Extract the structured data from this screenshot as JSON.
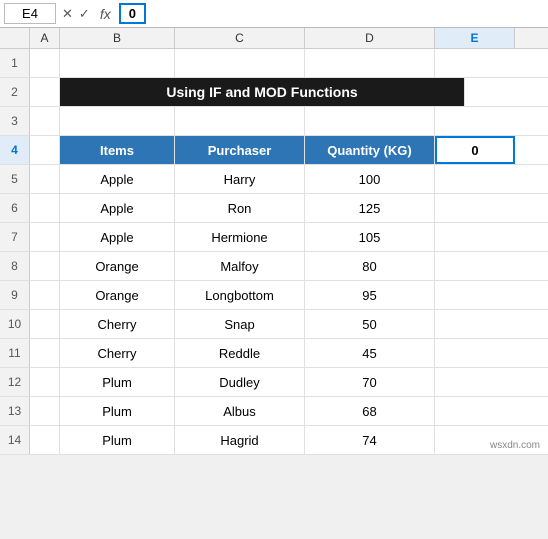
{
  "formulaBar": {
    "cellRef": "E4",
    "formula": "0",
    "fx": "fx"
  },
  "columns": [
    "",
    "A",
    "B",
    "C",
    "D",
    "E"
  ],
  "colLabels": {
    "a": "A",
    "b": "B",
    "c": "C",
    "d": "D",
    "e": "E"
  },
  "title": "Using  IF and MOD Functions",
  "tableHeaders": {
    "items": "Items",
    "purchaser": "Purchaser",
    "quantity": "Quantity (KG)",
    "e4": "0"
  },
  "rows": [
    {
      "num": "5",
      "items": "Apple",
      "purchaser": "Harry",
      "quantity": "100"
    },
    {
      "num": "6",
      "items": "Apple",
      "purchaser": "Ron",
      "quantity": "125"
    },
    {
      "num": "7",
      "items": "Apple",
      "purchaser": "Hermione",
      "quantity": "105"
    },
    {
      "num": "8",
      "items": "Orange",
      "purchaser": "Malfoy",
      "quantity": "80"
    },
    {
      "num": "9",
      "items": "Orange",
      "purchaser": "Longbottom",
      "quantity": "95"
    },
    {
      "num": "10",
      "items": "Cherry",
      "purchaser": "Snap",
      "quantity": "50"
    },
    {
      "num": "11",
      "items": "Cherry",
      "purchaser": "Reddle",
      "quantity": "45"
    },
    {
      "num": "12",
      "items": "Plum",
      "purchaser": "Dudley",
      "quantity": "70"
    },
    {
      "num": "13",
      "items": "Plum",
      "purchaser": "Albus",
      "quantity": "68"
    },
    {
      "num": "14",
      "items": "Plum",
      "purchaser": "Hagrid",
      "quantity": "74"
    }
  ],
  "emptyRows": [
    "1",
    "3"
  ],
  "watermark": "wsxdn.com"
}
